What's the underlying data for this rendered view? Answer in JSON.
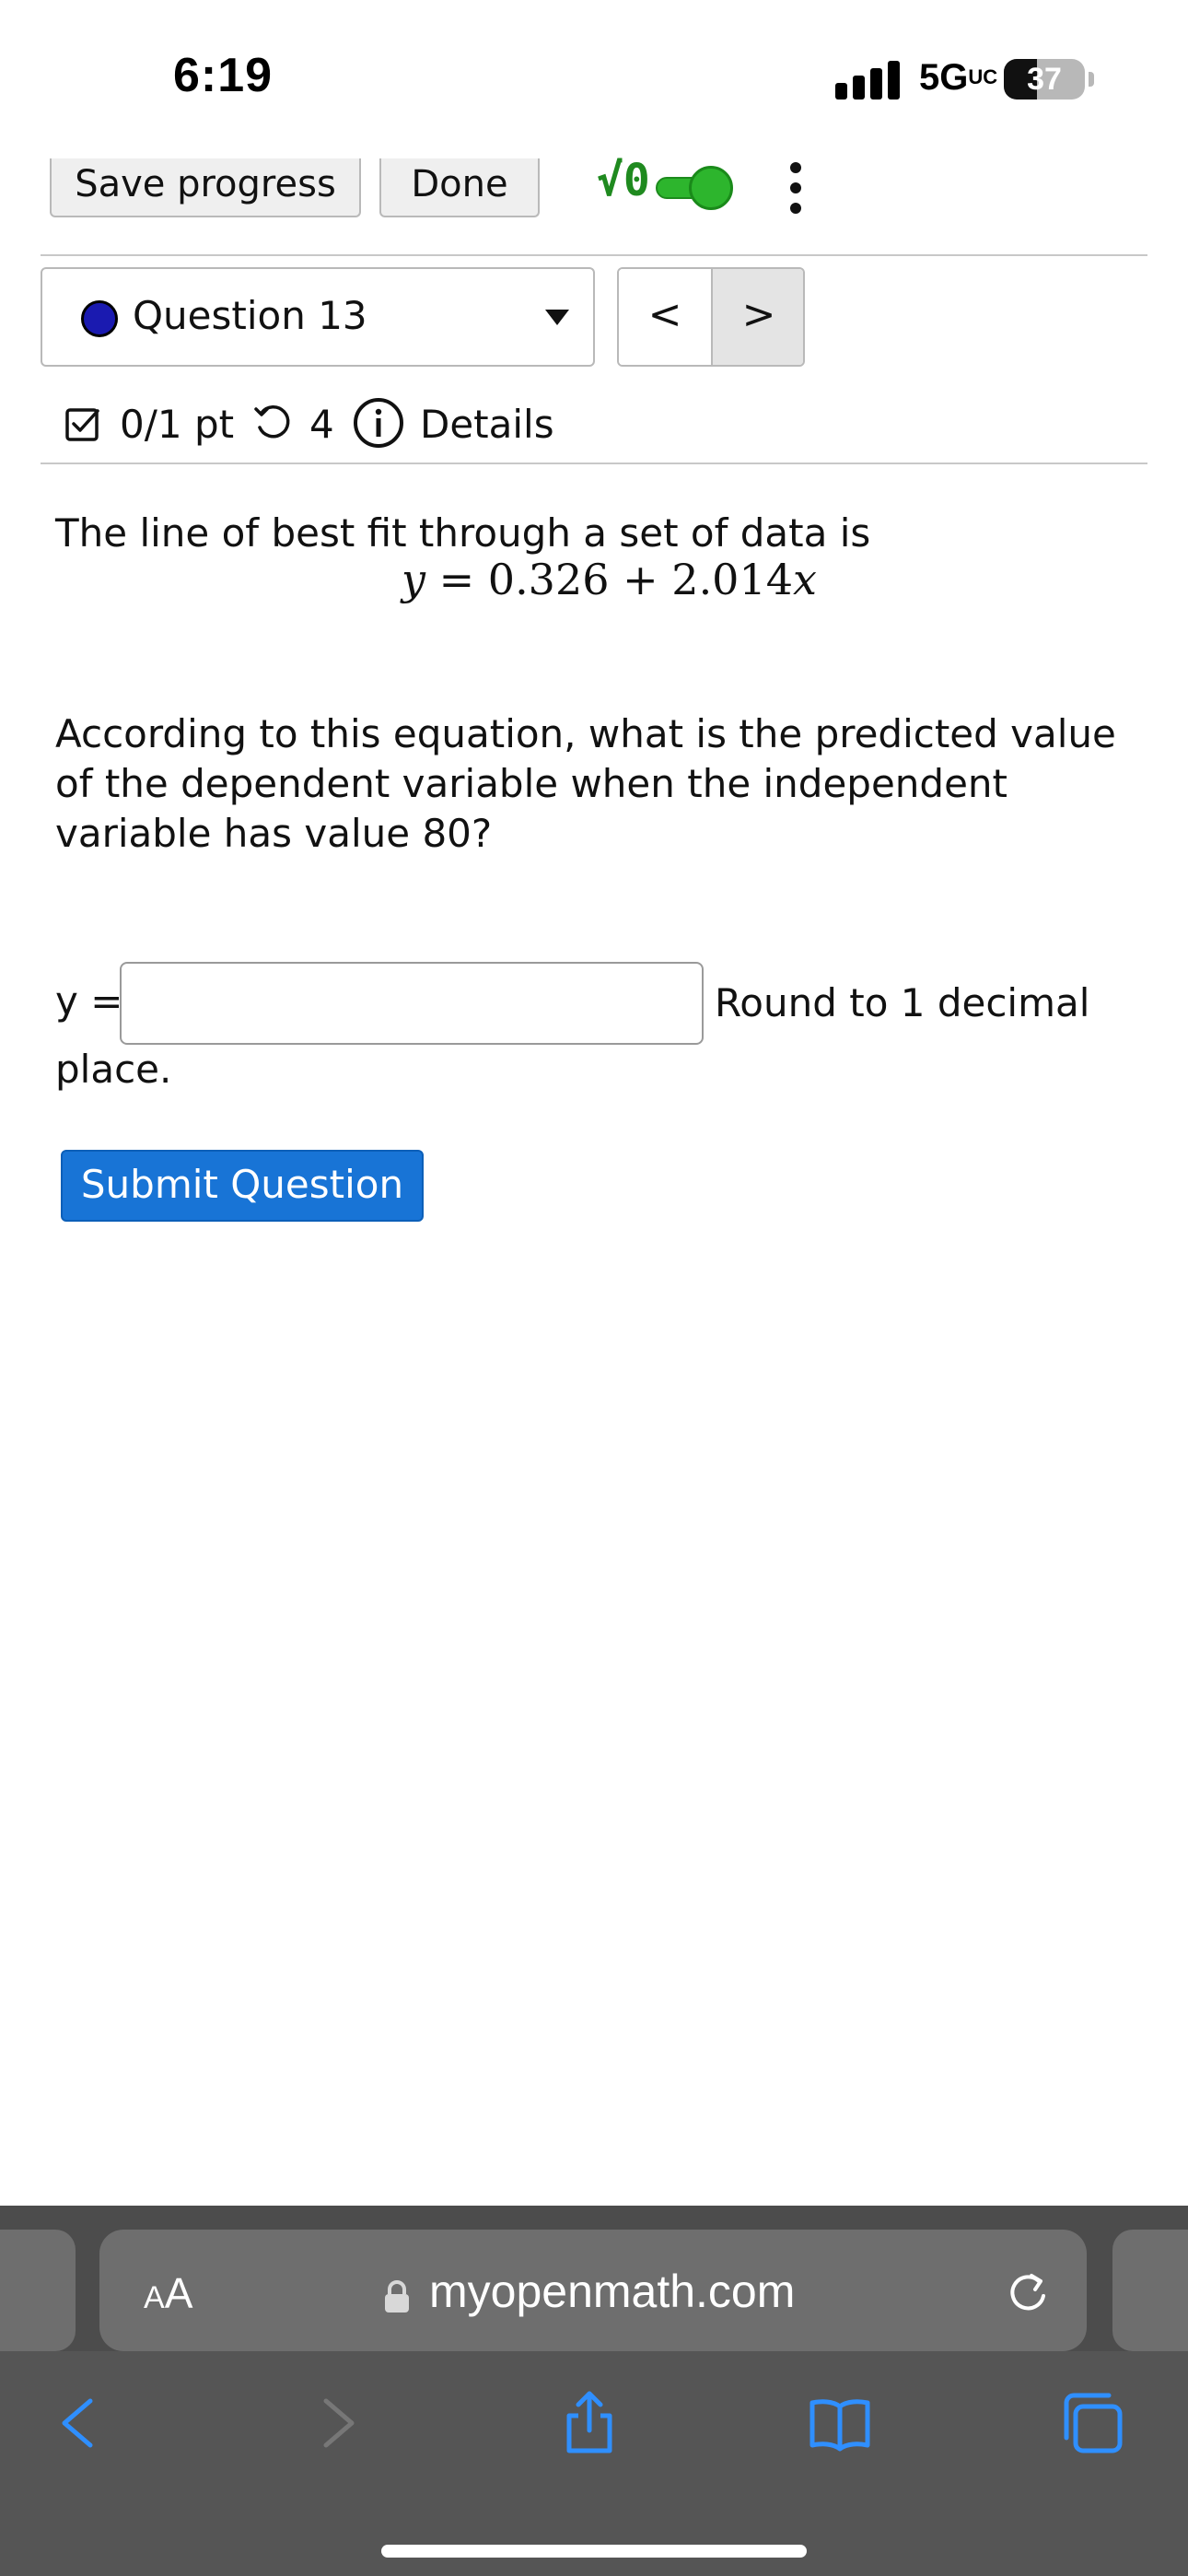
{
  "status_bar": {
    "time": "6:19",
    "network": "5G",
    "network_suffix": "UC",
    "battery": "37"
  },
  "toolbar": {
    "save_label": "Save progress",
    "done_label": "Done",
    "math_toggle_label": "√0",
    "math_toggle_on": true
  },
  "question_nav": {
    "selected": "Question 13",
    "prev": "<",
    "next": ">"
  },
  "info": {
    "score": "0/1 pt",
    "attempts": "4",
    "details": "Details"
  },
  "question": {
    "intro": "The line of best fit through a set of data is",
    "equation": {
      "lhs": "y",
      "eq": "=",
      "intercept": "0.326",
      "plus": "+",
      "slope": "2.014",
      "var": "x"
    },
    "prompt": "According to this equation, what is the predicted value of the dependent variable when the independent variable has value 80?",
    "answer_label": "y =",
    "answer_value": "",
    "round_text": "Round to 1 decimal",
    "round_text_cont": "place.",
    "submit_label": "Submit Question"
  },
  "browser": {
    "text_size_small": "A",
    "text_size_large": "A",
    "url": "myopenmath.com"
  },
  "colors": {
    "accent": "#1874d6",
    "toggle_green": "#2db52d",
    "chrome_bg": "#555555",
    "toolbar_icon": "#2f8fff"
  }
}
